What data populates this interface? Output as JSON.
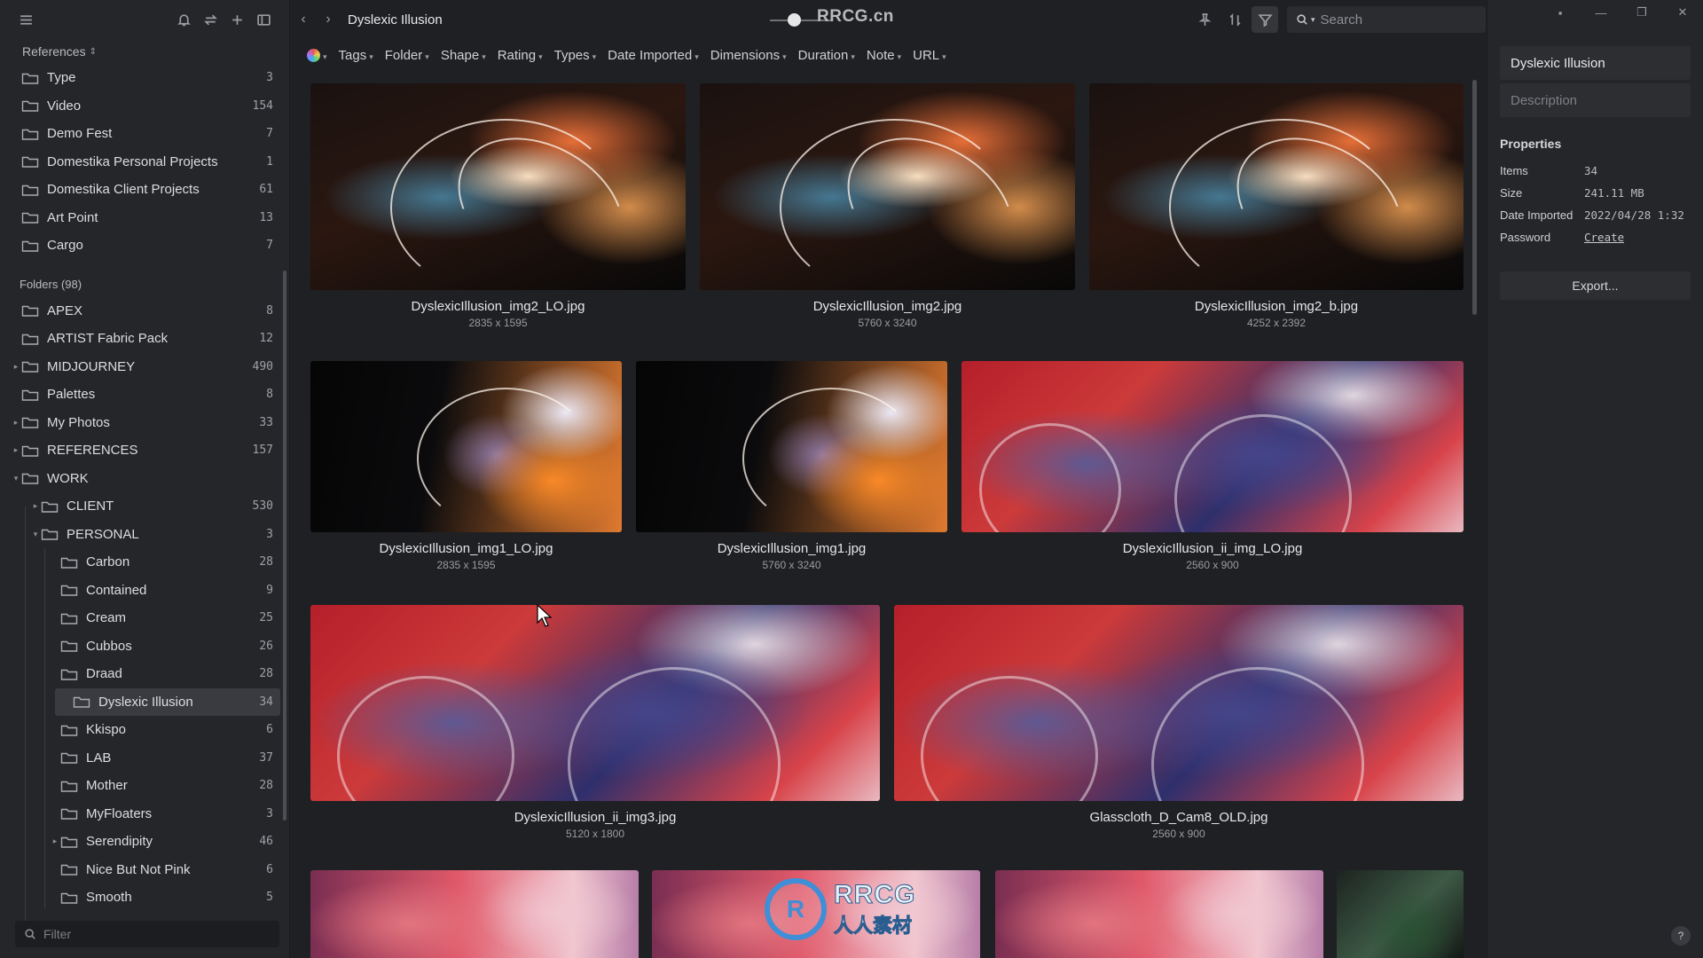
{
  "sidebar": {
    "references_label": "References",
    "reference_items": [
      {
        "label": "Type",
        "count": "3"
      },
      {
        "label": "Video",
        "count": "154"
      },
      {
        "label": "Demo Fest",
        "count": "7"
      },
      {
        "label": "Domestika Personal Projects",
        "count": "1"
      },
      {
        "label": "Domestika Client Projects",
        "count": "61"
      },
      {
        "label": "Art Point",
        "count": "13"
      },
      {
        "label": "Cargo",
        "count": "7"
      }
    ],
    "folders_label": "Folders (98)",
    "folders": [
      {
        "label": "APEX",
        "count": "8"
      },
      {
        "label": "ARTIST Fabric Pack",
        "count": "12"
      },
      {
        "label": "MIDJOURNEY",
        "count": "490"
      },
      {
        "label": "Palettes",
        "count": "8"
      },
      {
        "label": "My Photos",
        "count": "33"
      },
      {
        "label": "REFERENCES",
        "count": "157"
      },
      {
        "label": "WORK",
        "count": ""
      },
      {
        "label": "CLIENT",
        "count": "530"
      },
      {
        "label": "PERSONAL",
        "count": "3"
      },
      {
        "label": "Carbon",
        "count": "28"
      },
      {
        "label": "Contained",
        "count": "9"
      },
      {
        "label": "Cream",
        "count": "25"
      },
      {
        "label": "Cubbos",
        "count": "26"
      },
      {
        "label": "Draad",
        "count": "28"
      },
      {
        "label": "Dyslexic Illusion",
        "count": "34"
      },
      {
        "label": "Kkispo",
        "count": "6"
      },
      {
        "label": "LAB",
        "count": "37"
      },
      {
        "label": "Mother",
        "count": "28"
      },
      {
        "label": "MyFloaters",
        "count": "3"
      },
      {
        "label": "Serendipity",
        "count": "46"
      },
      {
        "label": "Nice But Not Pink",
        "count": "6"
      },
      {
        "label": "Smooth",
        "count": "5"
      }
    ],
    "filter_placeholder": "Filter"
  },
  "topbar": {
    "breadcrumb": "Dyslexic Illusion",
    "brand": "RRCG.cn",
    "search_placeholder": "Search"
  },
  "filters": [
    "Tags",
    "Folder",
    "Shape",
    "Rating",
    "Types",
    "Date Imported",
    "Dimensions",
    "Duration",
    "Note",
    "URL"
  ],
  "grid": {
    "items": [
      {
        "name": "DyslexicIllusion_img2_LO.jpg",
        "dims": "2835 x 1595"
      },
      {
        "name": "DyslexicIllusion_img2.jpg",
        "dims": "5760 x 3240"
      },
      {
        "name": "DyslexicIllusion_img2_b.jpg",
        "dims": "4252 x 2392"
      },
      {
        "name": "DyslexicIllusion_img1_LO.jpg",
        "dims": "2835 x 1595"
      },
      {
        "name": "DyslexicIllusion_img1.jpg",
        "dims": "5760 x 3240"
      },
      {
        "name": "DyslexicIllusion_ii_img_LO.jpg",
        "dims": "2560 x 900"
      },
      {
        "name": "DyslexicIllusion_ii_img3.jpg",
        "dims": "5120 x 1800"
      },
      {
        "name": "Glasscloth_D_Cam8_OLD.jpg",
        "dims": "2560 x 900"
      }
    ]
  },
  "watermark": {
    "line1": "RRCG",
    "line2": "人人素材"
  },
  "inspector": {
    "title": "Dyslexic Illusion",
    "description_placeholder": "Description",
    "properties_label": "Properties",
    "properties": [
      {
        "key": "Items",
        "value": "34"
      },
      {
        "key": "Size",
        "value": "241.11 MB"
      },
      {
        "key": "Date Imported",
        "value": "2022/04/28 1:32"
      },
      {
        "key": "Password",
        "value": "Create"
      }
    ],
    "export_label": "Export...",
    "help_label": "?"
  }
}
